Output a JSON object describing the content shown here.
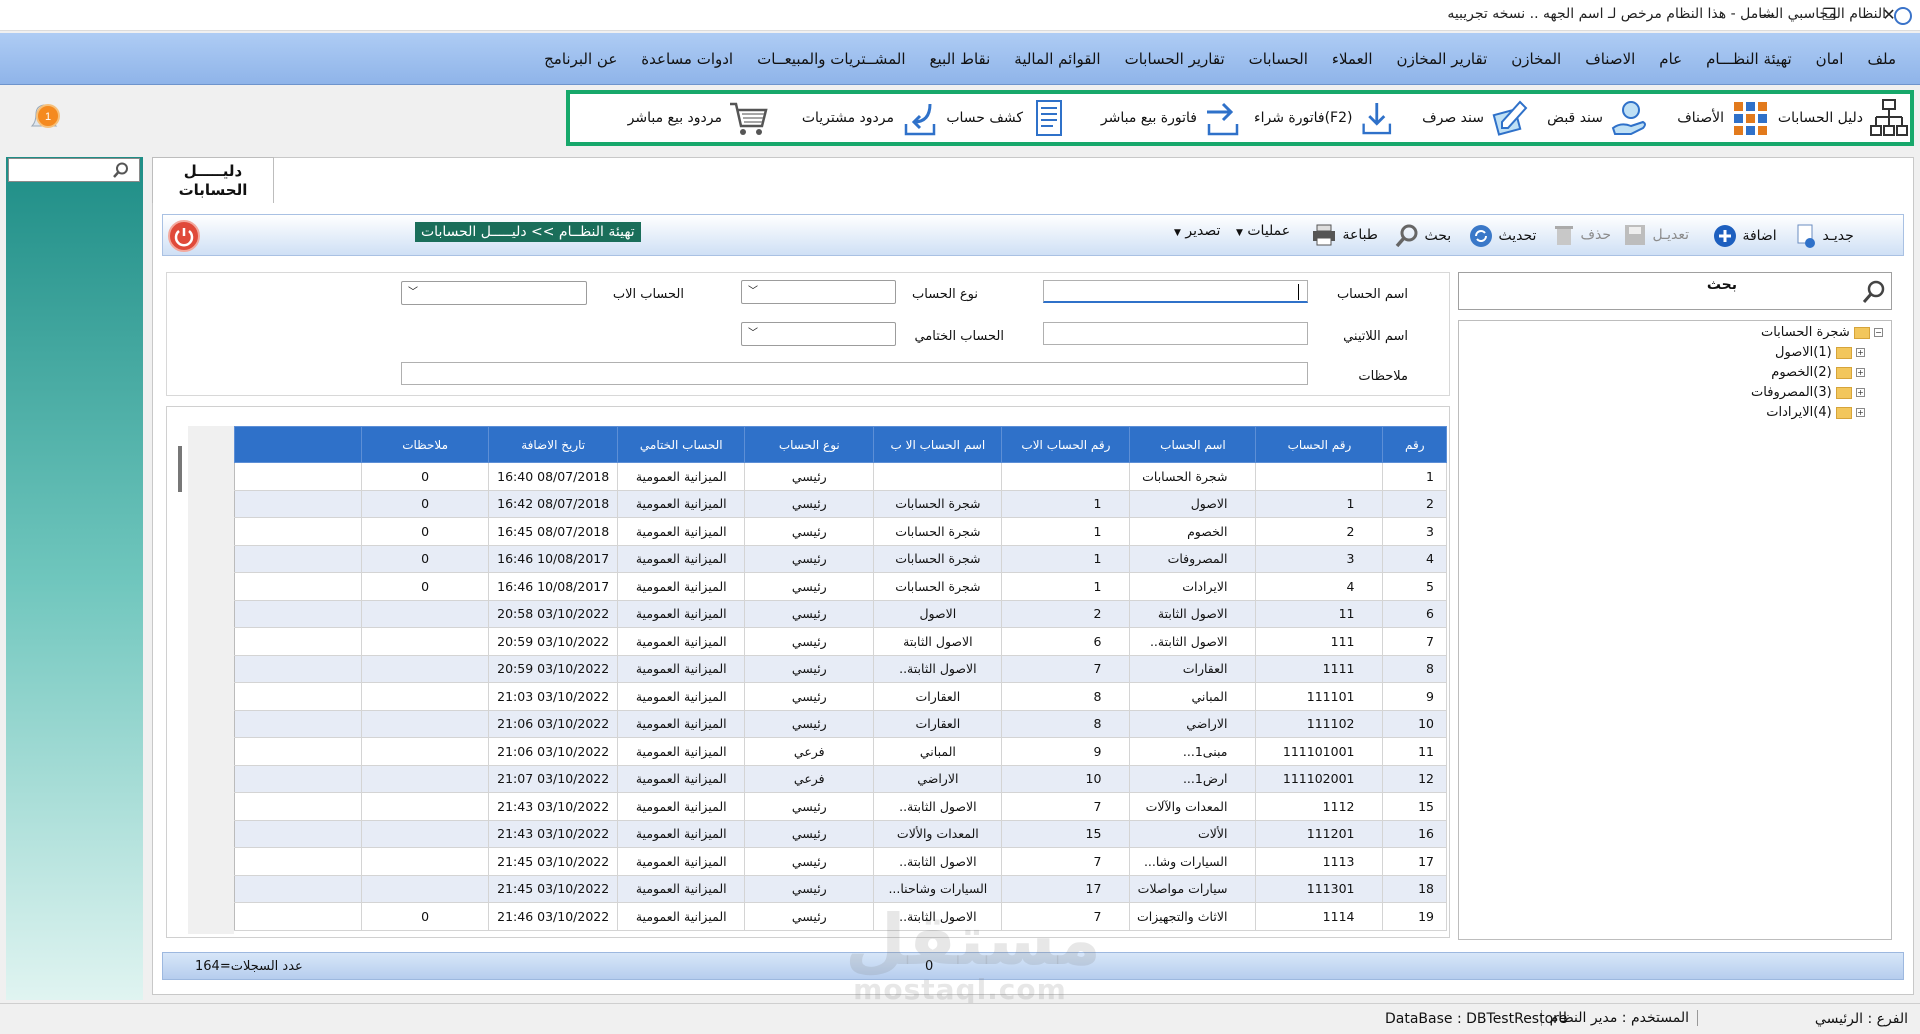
{
  "window": {
    "title": "النظام المحاسبي الشامل - هذا النظام مرخص لـ اسم الجهه .. نسخه تجريبيه",
    "minimize": "—",
    "restore": "❐",
    "close": "✕"
  },
  "menu": [
    "ملف",
    "امان",
    "تهيئة النظـــام",
    "عام",
    "الاصناف",
    "المخازن",
    "تقارير المخازن",
    "العملاء",
    "الحسابات",
    "تقارير الحسابات",
    "القوائم المالية",
    "نقاط البيع",
    "المشــتريات والمبيعــات",
    "ادوات مساعدة",
    "عن البرنامج"
  ],
  "toolbar": [
    {
      "label": "دليل الحسابات",
      "icon": "org-chart-icon"
    },
    {
      "label": "الأصناف",
      "icon": "items-grid-icon"
    },
    {
      "label": "سند قبض",
      "icon": "receipt-hand-icon"
    },
    {
      "label": "سند صرف",
      "icon": "payment-pen-icon"
    },
    {
      "label": "فاتورة شراء(F2)",
      "icon": "purchase-arrow-icon"
    },
    {
      "label": "فاتورة بيع مباشر",
      "icon": "sale-arrow-icon"
    },
    {
      "label": "كشف حساب",
      "icon": "statement-doc-icon"
    },
    {
      "label": "مردود مشتريات",
      "icon": "return-arrow-icon"
    },
    {
      "label": "مردود بيع مباشر",
      "icon": "cart-icon"
    }
  ],
  "notifications": {
    "count": "1"
  },
  "tab": {
    "label": "دليـــــل الحسابات"
  },
  "breadcrumb": "تهيئة النظــام >> دليـــــل الحسابات",
  "actions": {
    "new": "جديـد",
    "add": "اضافة",
    "edit": "تعديـل",
    "delete": "حذف",
    "refresh": "تحديث",
    "search": "بحث",
    "print": "طباعة",
    "operations": "عمليات",
    "export": "تصدير"
  },
  "form": {
    "account_name": "اسم الحساب",
    "latin_name": "اسم اللاتيني",
    "notes": "ملاحظات",
    "account_type": "نوع الحساب",
    "final_account": "الحساب الختامي",
    "parent_account": "الحساب الاب"
  },
  "tree": {
    "search_label": "بحث",
    "root": "شجرة الحسابات",
    "children": [
      "(1)الاصول",
      "(2)الخصوم",
      "(3)المصروفات",
      "(4)الايرادات"
    ]
  },
  "grid": {
    "columns": [
      "رقم",
      "رقم الحساب",
      "اسم الحساب",
      "رقم الحساب الاب",
      "اسم الحساب الا ب",
      "نوع الحساب",
      "الحساب الختامي",
      "تاريخ الاضافة",
      "ملاحظات"
    ],
    "rows": [
      [
        "1",
        "",
        "شجرة الحسابات",
        "",
        "",
        "رئيسي",
        "الميزانية العمومية",
        "08/07/2018 16:40",
        "0"
      ],
      [
        "2",
        "1",
        "الاصول",
        "1",
        "شجرة الحسابات",
        "رئيسي",
        "الميزانية العمومية",
        "08/07/2018 16:42",
        "0"
      ],
      [
        "3",
        "2",
        "الخصوم",
        "1",
        "شجرة الحسابات",
        "رئيسي",
        "الميزانية العمومية",
        "08/07/2018 16:45",
        "0"
      ],
      [
        "4",
        "3",
        "المصروفات",
        "1",
        "شجرة الحسابات",
        "رئيسي",
        "الميزانية العمومية",
        "10/08/2017 16:46",
        "0"
      ],
      [
        "5",
        "4",
        "الايرادات",
        "1",
        "شجرة الحسابات",
        "رئيسي",
        "الميزانية العمومية",
        "10/08/2017 16:46",
        "0"
      ],
      [
        "6",
        "11",
        "الاصول الثابتة",
        "2",
        "الاصول",
        "رئيسي",
        "الميزانية العمومية",
        "03/10/2022 20:58",
        ""
      ],
      [
        "7",
        "111",
        "الاصول الثابتة..",
        "6",
        "الاصول الثابتة",
        "رئيسي",
        "الميزانية العمومية",
        "03/10/2022 20:59",
        ""
      ],
      [
        "8",
        "1111",
        "العقارات",
        "7",
        "الاصول الثابتة..",
        "رئيسي",
        "الميزانية العمومية",
        "03/10/2022 20:59",
        ""
      ],
      [
        "9",
        "111101",
        "المباني",
        "8",
        "العقارات",
        "رئيسي",
        "الميزانية العمومية",
        "03/10/2022 21:03",
        ""
      ],
      [
        "10",
        "111102",
        "الاراضي",
        "8",
        "العقارات",
        "رئيسي",
        "الميزانية العمومية",
        "03/10/2022 21:06",
        ""
      ],
      [
        "11",
        "111101001",
        "مبنى1...",
        "9",
        "المباني",
        "فرعي",
        "الميزانية العمومية",
        "03/10/2022 21:06",
        ""
      ],
      [
        "12",
        "111102001",
        "ارض1...",
        "10",
        "الاراضي",
        "فرعي",
        "الميزانية العمومية",
        "03/10/2022 21:07",
        ""
      ],
      [
        "15",
        "1112",
        "المعدات والآلات",
        "7",
        "الاصول الثابتة..",
        "رئيسي",
        "الميزانية العمومية",
        "03/10/2022 21:43",
        ""
      ],
      [
        "16",
        "111201",
        "الألات",
        "15",
        "المعدات والألات",
        "رئيسي",
        "الميزانية العمومية",
        "03/10/2022 21:43",
        ""
      ],
      [
        "17",
        "1113",
        "السيارات وشا...",
        "7",
        "الاصول الثابتة..",
        "رئيسي",
        "الميزانية العمومية",
        "03/10/2022 21:45",
        ""
      ],
      [
        "18",
        "111301",
        "سيارات مواصلات",
        "17",
        "السيارات وشاحنا...",
        "رئيسي",
        "الميزانية العمومية",
        "03/10/2022 21:45",
        ""
      ],
      [
        "19",
        "1114",
        "الاثاث والتجهيزات",
        "7",
        "الاصول الثابتة..",
        "رئيسي",
        "الميزانية العمومية",
        "03/10/2022 21:46",
        "0"
      ]
    ]
  },
  "footer": {
    "records": "عدد السجلات=164",
    "value": "0"
  },
  "status": {
    "branch": "الفرع : الرئيسي",
    "user": "المستخدم : مدير النظام",
    "database": "DataBase : DBTestRestore"
  },
  "watermark": {
    "logo_text": "مستقل",
    "domain": "mostaql.com"
  },
  "colors": {
    "accent": "#2f71c9",
    "toolbar_border": "#17a86b",
    "menu": "#9dbdee",
    "notify": "#f58a1f"
  }
}
